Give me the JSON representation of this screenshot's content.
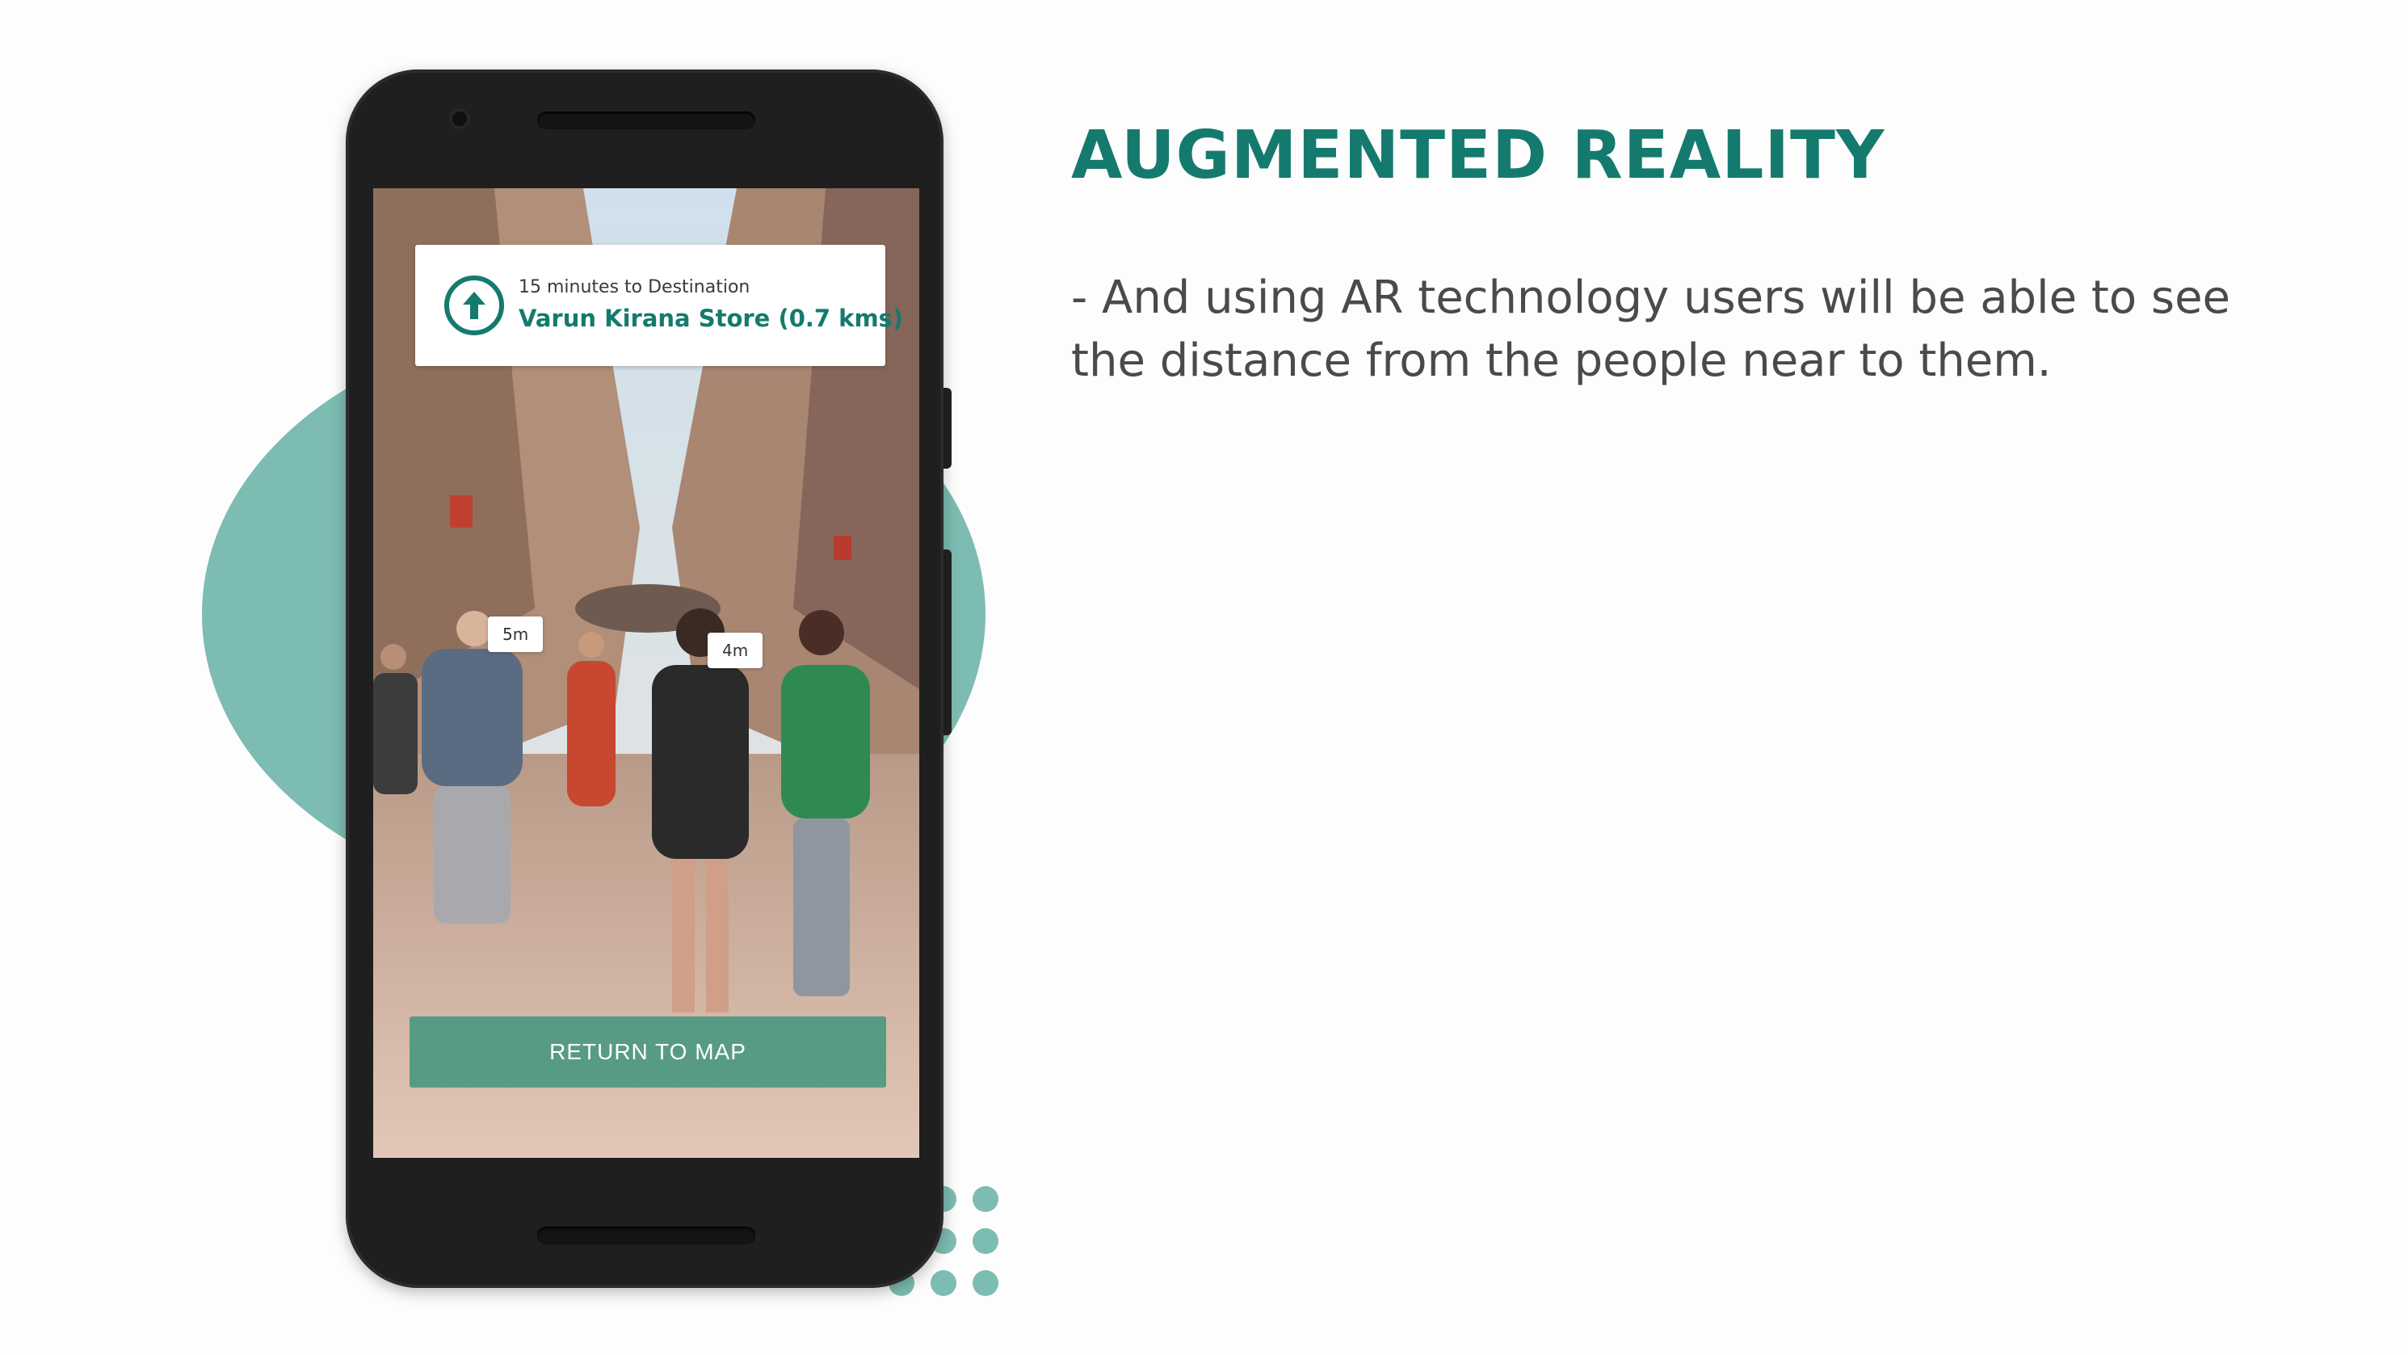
{
  "slide": {
    "heading": "AUGMENTED REALITY",
    "body": "- And using AR technology users will be able to see the distance from the people near to them."
  },
  "phone": {
    "navigation": {
      "eta_text": "15 minutes to Destination",
      "destination": "Varun Kirana Store (0.7 kms)",
      "direction_icon": "arrow-up-icon"
    },
    "distance_tags": [
      "5m",
      "4m"
    ],
    "return_button_label": "RETURN TO MAP"
  },
  "colors": {
    "accent": "#157a6e",
    "blob": "#7dbcb2",
    "button": "#46967f"
  }
}
